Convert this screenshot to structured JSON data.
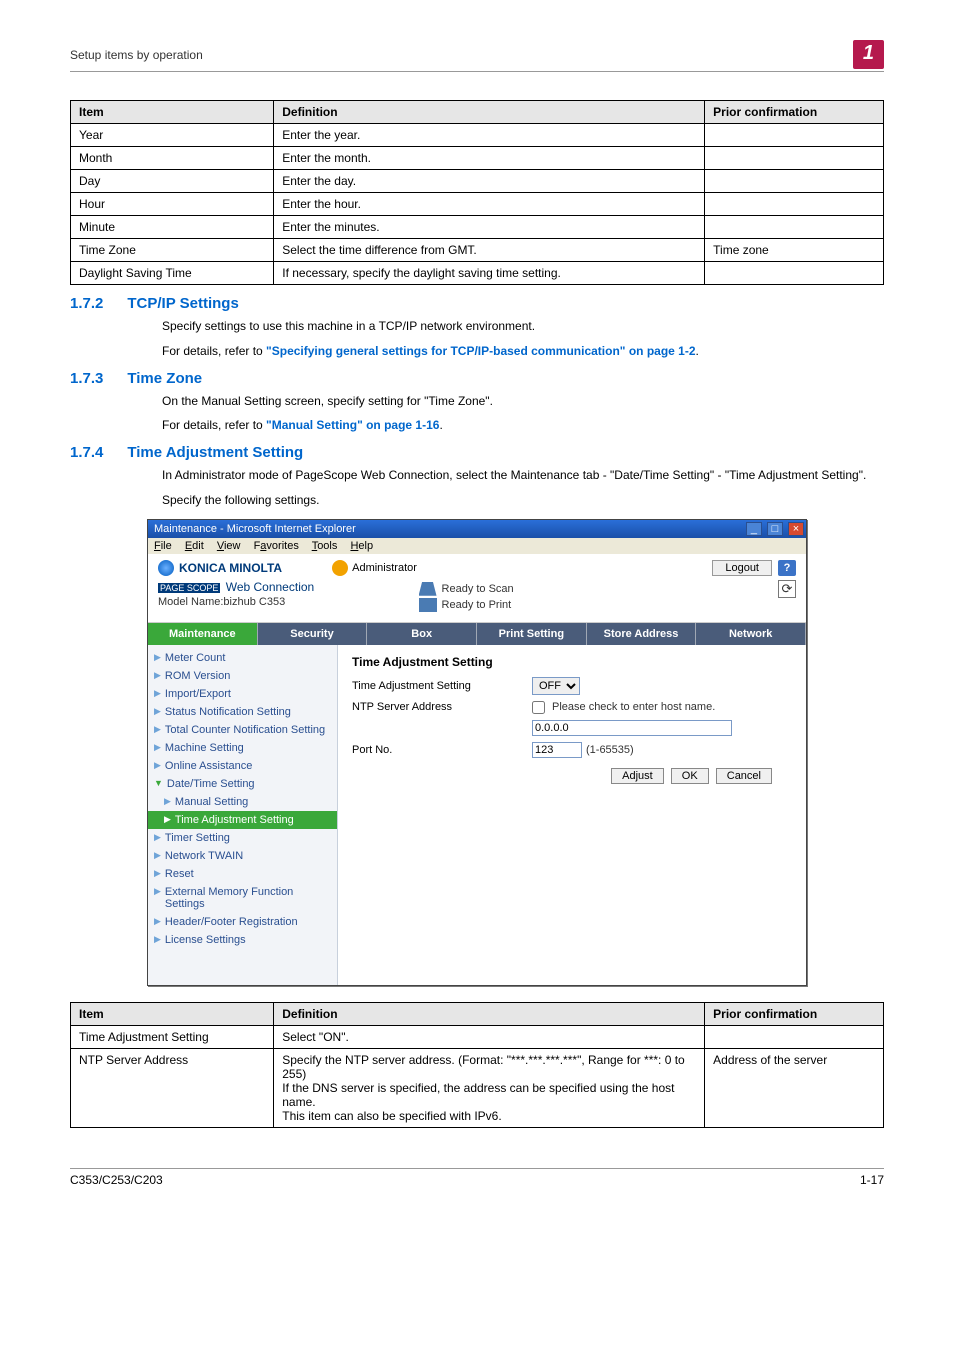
{
  "page": {
    "running_header": "Setup items by operation",
    "running_badge": "1",
    "footer_left": "C353/C253/C203",
    "footer_right": "1-17"
  },
  "table1": {
    "headers": [
      "Item",
      "Definition",
      "Prior confirmation"
    ],
    "rows": [
      [
        "Year",
        "Enter the year.",
        ""
      ],
      [
        "Month",
        "Enter the month.",
        ""
      ],
      [
        "Day",
        "Enter the day.",
        ""
      ],
      [
        "Hour",
        "Enter the hour.",
        ""
      ],
      [
        "Minute",
        "Enter the minutes.",
        ""
      ],
      [
        "Time Zone",
        "Select the time difference from GMT.",
        "Time zone"
      ],
      [
        "Daylight Saving Time",
        "If necessary, specify the daylight saving time setting.",
        ""
      ]
    ]
  },
  "sec172": {
    "num": "1.7.2",
    "title": "TCP/IP Settings",
    "p1": "Specify settings to use this machine in a TCP/IP network environment.",
    "p2a": "For details, refer to ",
    "p2link": "\"Specifying general settings for TCP/IP-based communication\" on page 1-2",
    "p2b": "."
  },
  "sec173": {
    "num": "1.7.3",
    "title": "Time Zone",
    "p1": "On the Manual Setting screen, specify setting for \"Time Zone\".",
    "p2a": "For details, refer to ",
    "p2link": "\"Manual Setting\" on page 1-16",
    "p2b": "."
  },
  "sec174": {
    "num": "1.7.4",
    "title": "Time Adjustment Setting",
    "p1": "In Administrator mode of PageScope Web Connection, select the Maintenance tab - \"Date/Time Setting\" - \"Time Adjustment Setting\".",
    "p2": "Specify the following settings."
  },
  "ss": {
    "window_title": "Maintenance - Microsoft Internet Explorer",
    "menu": [
      "File",
      "Edit",
      "View",
      "Favorites",
      "Tools",
      "Help"
    ],
    "brand": "KONICA MINOLTA",
    "admin": "Administrator",
    "logout": "Logout",
    "help": "?",
    "pagescope": "PAGE SCOPE",
    "webconn": "Web Connection",
    "model": "Model Name:bizhub C353",
    "ready_scan": "Ready to Scan",
    "ready_print": "Ready to Print",
    "tabs": [
      "Maintenance",
      "Security",
      "Box",
      "Print Setting",
      "Store Address",
      "Network"
    ],
    "side": [
      "Meter Count",
      "ROM Version",
      "Import/Export",
      "Status Notification Setting",
      "Total Counter Notification Setting",
      "Machine Setting",
      "Online Assistance",
      "Date/Time Setting",
      "Manual Setting",
      "Time Adjustment Setting",
      "Timer Setting",
      "Network TWAIN",
      "Reset",
      "External Memory Function Settings",
      "Header/Footer Registration",
      "License Settings"
    ],
    "main_title": "Time Adjustment Setting",
    "f_tas": "Time Adjustment Setting",
    "f_tas_val": "OFF",
    "f_ntp": "NTP Server Address",
    "f_ntp_chk": "Please check to enter host name.",
    "f_ntp_val": "0.0.0.0",
    "f_port": "Port No.",
    "f_port_val": "123",
    "f_port_range": "(1-65535)",
    "btn_adjust": "Adjust",
    "btn_ok": "OK",
    "btn_cancel": "Cancel"
  },
  "table2": {
    "headers": [
      "Item",
      "Definition",
      "Prior confirmation"
    ],
    "rows": [
      [
        "Time Adjustment Setting",
        "Select \"ON\".",
        ""
      ],
      [
        "NTP Server Address",
        "Specify the NTP server address. (Format: \"***.***.***.***\", Range for ***: 0 to 255)\nIf the DNS server is specified, the address can be specified using the host name.\nThis item can also be specified with IPv6.",
        "Address of the server"
      ]
    ]
  }
}
